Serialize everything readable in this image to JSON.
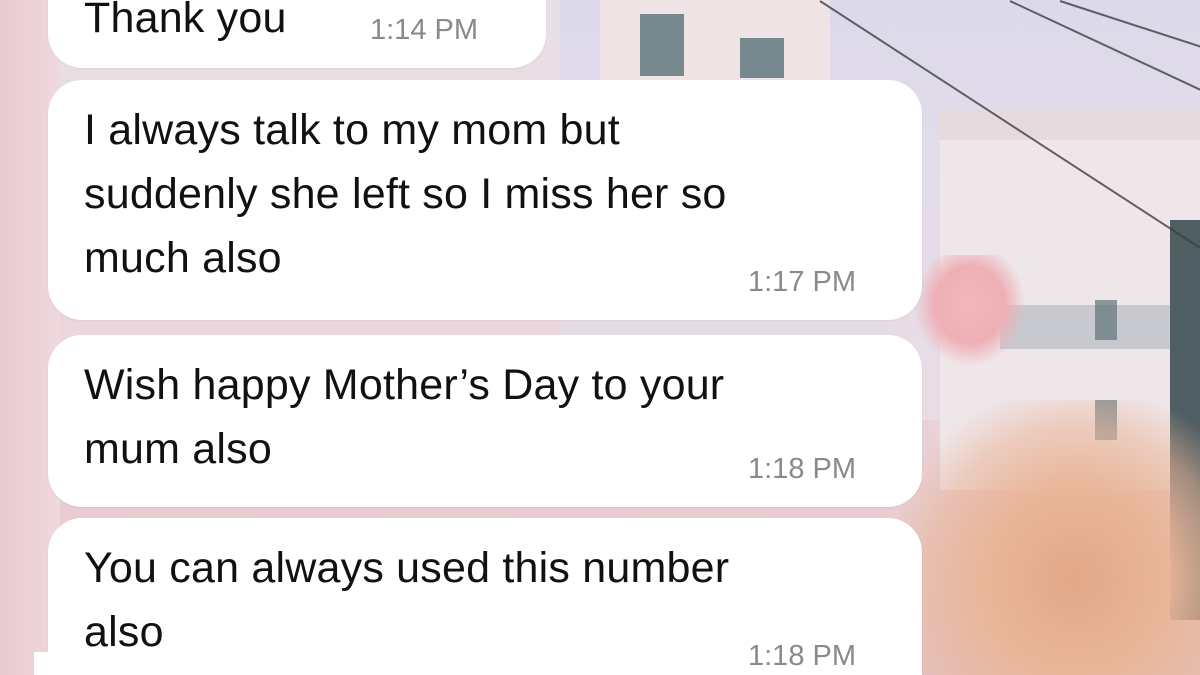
{
  "conversation": {
    "messages": [
      {
        "text": "Thank you",
        "time": "1:14 PM"
      },
      {
        "text": "I always talk to my mom but\nsuddenly she left so I miss her so\nmuch also",
        "time": "1:17 PM"
      },
      {
        "text": "Wish happy Mother’s Day to your\nmum also",
        "time": "1:18 PM"
      },
      {
        "text": "You can always used this number\nalso",
        "time": "1:18 PM"
      }
    ]
  },
  "colors": {
    "bubble": "#ffffff",
    "text": "#111111",
    "timestamp": "#8a8a8e",
    "wallpaper_tint": "#ecd9df"
  }
}
